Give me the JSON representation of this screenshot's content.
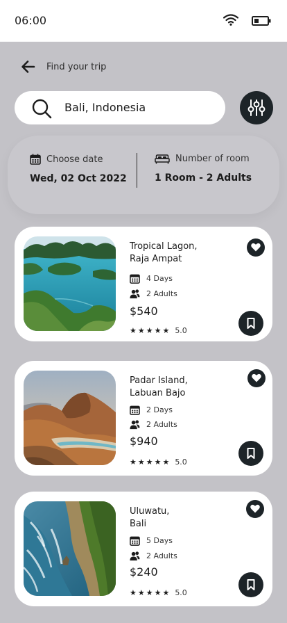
{
  "status_bar": {
    "time": "06:00",
    "icons": [
      "wifi-icon",
      "battery-icon"
    ]
  },
  "header": {
    "title": "Find your trip",
    "back_icon": "arrow-left-icon"
  },
  "search": {
    "value": "Bali, Indonesia",
    "icon": "search-icon",
    "filter_icon": "sliders-icon"
  },
  "booking": {
    "date_label": "Choose date",
    "date_value": "Wed, 02 Oct 2022",
    "room_label": "Number of room",
    "room_value": "1 Room - 2 Adults"
  },
  "trips": [
    {
      "name_line1": "Tropical Lagon,",
      "name_line2": "Raja Ampat",
      "days": "4 Days",
      "adults": "2 Adults",
      "price": "$540",
      "stars": "★★★★★",
      "rating": "5.0"
    },
    {
      "name_line1": "Padar Island,",
      "name_line2": "Labuan Bajo",
      "days": "2 Days",
      "adults": "2 Adults",
      "price": "$940",
      "stars": "★★★★★",
      "rating": "5.0"
    },
    {
      "name_line1": "Uluwatu,",
      "name_line2": "Bali",
      "days": "5 Days",
      "adults": "2 Adults",
      "price": "$240",
      "stars": "★★★★★",
      "rating": "5.0"
    }
  ],
  "colors": {
    "background": "#c3c2c7",
    "dark": "#1d2428",
    "card": "#ffffff"
  }
}
